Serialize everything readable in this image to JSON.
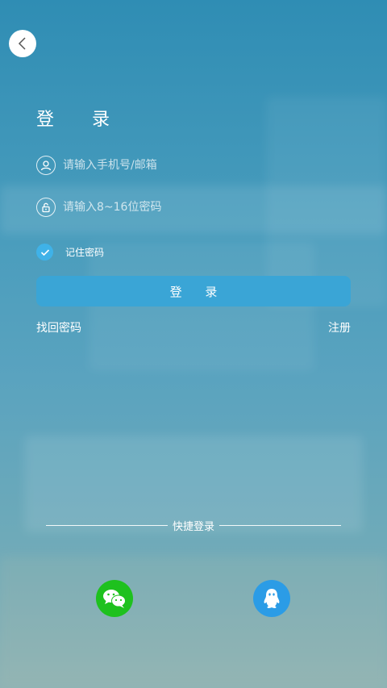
{
  "login": {
    "title": "登 录",
    "phone_placeholder": "请输入手机号/邮箱",
    "password_placeholder": "请输入8~16位密码",
    "remember_label": "记住密码",
    "remember_checked": true,
    "login_button": "登 录",
    "forgot_password": "找回密码",
    "register": "注册"
  },
  "quick_login": {
    "label": "快捷登录",
    "providers": [
      "wechat-icon",
      "qq-icon"
    ]
  },
  "icons": {
    "back": "chevron-left-icon",
    "user": "user-icon",
    "lock": "lock-icon",
    "check": "check-icon"
  },
  "colors": {
    "accent": "#3aa5d6",
    "checkbox": "#3fb2e8",
    "wechat": "#1ec11e",
    "qq": "#2b9ce6"
  }
}
